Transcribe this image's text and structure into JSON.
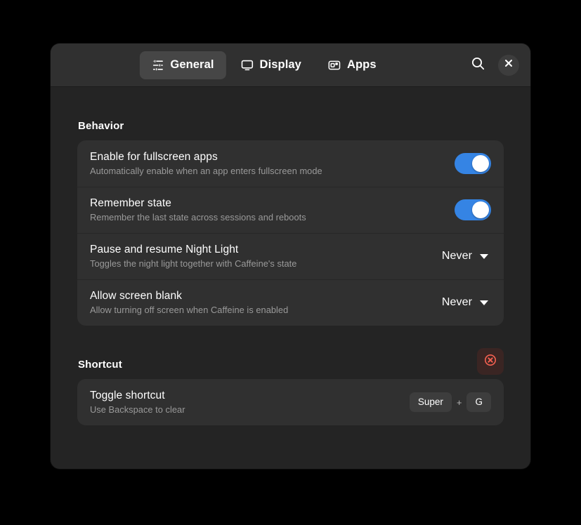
{
  "window": {
    "tabs": [
      {
        "label": "General",
        "icon": "sliders-icon",
        "active": true
      },
      {
        "label": "Display",
        "icon": "monitor-icon",
        "active": false
      },
      {
        "label": "Apps",
        "icon": "apps-icon",
        "active": false
      }
    ],
    "header_actions": [
      {
        "name": "search-button",
        "icon": "search-icon"
      },
      {
        "name": "close-button",
        "icon": "close-icon"
      }
    ]
  },
  "behavior": {
    "title": "Behavior",
    "rows": [
      {
        "title": "Enable for fullscreen apps",
        "subtitle": "Automatically enable when an app enters fullscreen mode",
        "control": "switch",
        "value": "on"
      },
      {
        "title": "Remember state",
        "subtitle": "Remember the last state across sessions and reboots",
        "control": "switch",
        "value": "on"
      },
      {
        "title": "Pause and resume Night Light",
        "subtitle": "Toggles the night light together with Caffeine's state",
        "control": "dropdown",
        "value": "Never"
      },
      {
        "title": "Allow screen blank",
        "subtitle": "Allow turning off screen when Caffeine is enabled",
        "control": "dropdown",
        "value": "Never"
      }
    ]
  },
  "shortcut": {
    "title": "Shortcut",
    "reset_icon": "reset-circle-x-icon",
    "row": {
      "title": "Toggle shortcut",
      "subtitle": "Use Backspace to clear",
      "keys": [
        "Super",
        "G"
      ],
      "separator": "+"
    }
  },
  "colors": {
    "accent": "#3584e4",
    "destructive": "#f66151",
    "window_bg": "#242424",
    "header_bg": "#303030",
    "card_bg": "#303030"
  }
}
